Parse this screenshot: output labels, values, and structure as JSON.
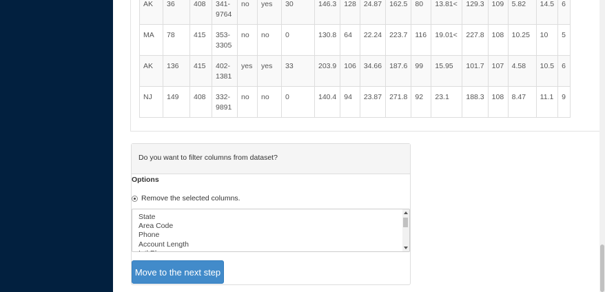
{
  "table": {
    "rows": [
      [
        "AK",
        "36",
        "408",
        "341-9764",
        "no",
        "yes",
        "30",
        "146.3",
        "128",
        "24.87",
        "162.5",
        "80",
        "13.81<",
        "129.3",
        "109",
        "5.82",
        "14.5",
        "6"
      ],
      [
        "MA",
        "78",
        "415",
        "353-3305",
        "no",
        "no",
        "0",
        "130.8",
        "64",
        "22.24",
        "223.7",
        "116",
        "19.01<",
        "227.8",
        "108",
        "10.25",
        "10",
        "5"
      ],
      [
        "AK",
        "136",
        "415",
        "402-1381",
        "yes",
        "yes",
        "33",
        "203.9",
        "106",
        "34.66",
        "187.6",
        "99",
        "15.95",
        "101.7",
        "107",
        "4.58",
        "10.5",
        "6"
      ],
      [
        "NJ",
        "149",
        "408",
        "332-9891",
        "no",
        "no",
        "0",
        "140.4",
        "94",
        "23.87",
        "271.8",
        "92",
        "23.1",
        "188.3",
        "108",
        "8.47",
        "11.1",
        "9"
      ]
    ]
  },
  "filter": {
    "question": "Do you want to filter columns from dataset?",
    "options_label": "Options",
    "radio_label": "Remove the selected columns.",
    "columns": [
      "State",
      "Area Code",
      "Phone",
      "Account Length",
      "Intl Plan"
    ],
    "next_button": "Move to the next step"
  }
}
